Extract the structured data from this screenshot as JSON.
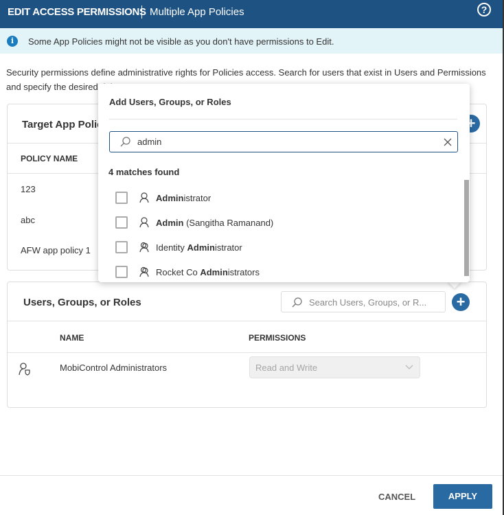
{
  "header": {
    "title": "EDIT ACCESS PERMISSIONS",
    "subtitle": "Multiple App Policies",
    "help_icon": "question-circle-icon"
  },
  "info": {
    "text": "Some App Policies might not be visible as you don't have permissions to Edit."
  },
  "description": "Security permissions define administrative rights for Policies access. Search for users that exist in Users and Permissions and specify the desired rights.",
  "target_card": {
    "title": "Target App Policies",
    "column": "POLICY NAME",
    "rows": [
      "123",
      "abc",
      "AFW app policy 1"
    ]
  },
  "users_card": {
    "title": "Users, Groups, or Roles",
    "search_placeholder": "Search Users, Groups, or R...",
    "columns": {
      "name": "NAME",
      "permissions": "PERMISSIONS"
    },
    "rows": [
      {
        "name": "MobiControl Administrators",
        "permission": "Read and Write",
        "icon": "admin-role-icon"
      }
    ]
  },
  "popup": {
    "title": "Add Users, Groups, or Roles",
    "search_value": "admin",
    "matches": "4 matches found",
    "options": [
      {
        "pre": "",
        "bold": "Admin",
        "post": "istrator",
        "icon": "user-icon"
      },
      {
        "pre": "",
        "bold": "Admin",
        "post": " (Sangitha Ramanand)",
        "icon": "user-icon"
      },
      {
        "pre": "Identity ",
        "bold": "Admin",
        "post": "istrator",
        "icon": "group-icon"
      },
      {
        "pre": "Rocket Co ",
        "bold": "Admin",
        "post": "istrators",
        "icon": "group-icon"
      }
    ]
  },
  "footer": {
    "cancel": "CANCEL",
    "apply": "APPLY"
  },
  "colors": {
    "header": "#1e5282",
    "primary": "#2a6aa3",
    "info_bg": "#e3f4f8"
  }
}
